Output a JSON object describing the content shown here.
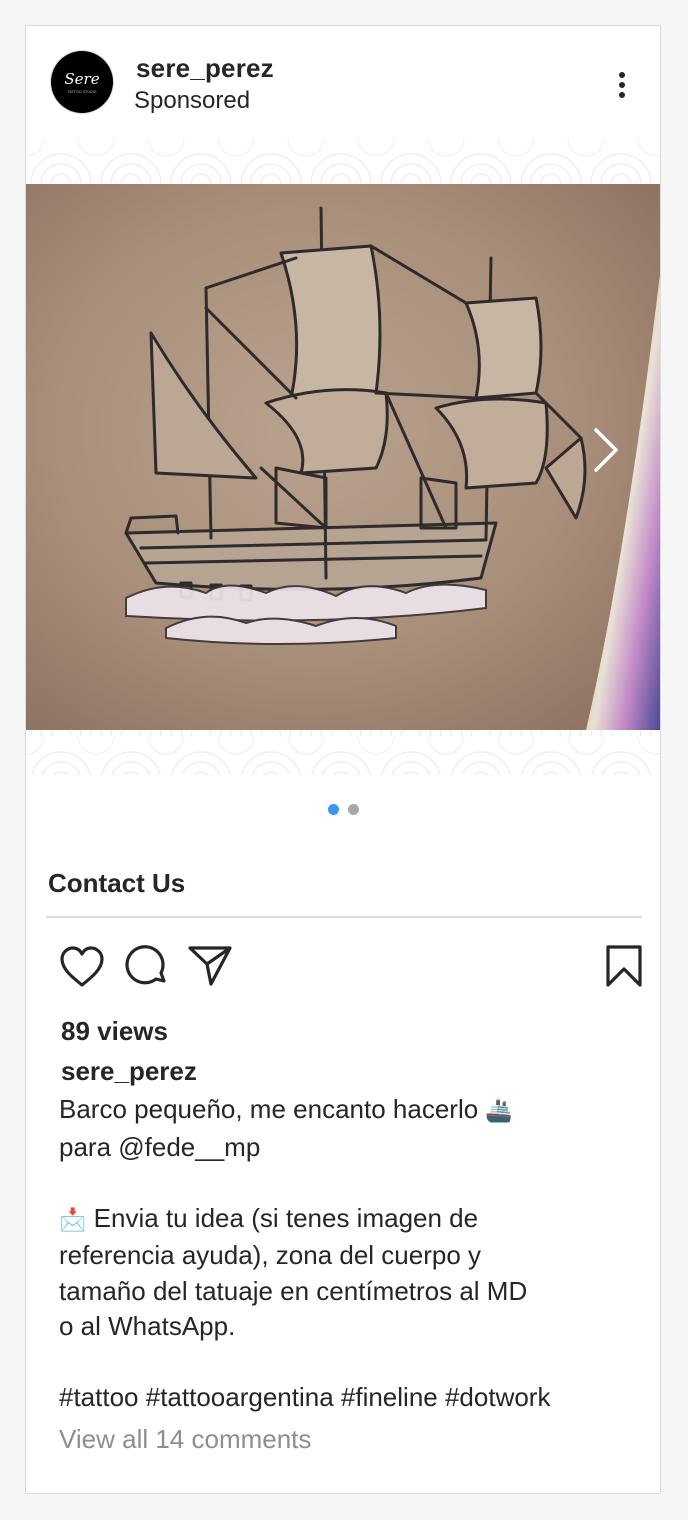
{
  "post": {
    "username": "sere_perez",
    "sponsored_label": "Sponsored",
    "avatar_text": "Sere",
    "avatar_subtext": "TATTOO STUDIO"
  },
  "carousel": {
    "count": 2,
    "active_index": 0,
    "image_subject": "fine-line dotwork tattoo of a sailing ship on skin"
  },
  "cta": {
    "label": "Contact Us"
  },
  "actions": {
    "icons": [
      "heart-icon",
      "comment-icon",
      "share-icon",
      "bookmark-icon"
    ]
  },
  "stats": {
    "views": "89 views"
  },
  "caption": {
    "username": "sere_perez",
    "line1": "Barco pequeño, me encanto hacerlo",
    "line1_emoji": "🚢",
    "line2": "para @fede__mp",
    "para2_emoji": "📩",
    "para2": "Envia tu idea (si tenes imagen de\nreferencia ayuda), zona del cuerpo y\ntamaño del tatuaje en centímetros al MD\no al WhatsApp.",
    "hashtags": "#tattoo #tattooargentina #fineline #dotwork"
  },
  "comments": {
    "view_all": "View all 14 comments"
  },
  "colors": {
    "text": "#262626",
    "secondary_text": "#8e8e8e",
    "border": "#dbdbdb",
    "active_dot": "#3897f0",
    "inactive_dot": "#a8a8a8",
    "background": "#f6f6f6"
  }
}
